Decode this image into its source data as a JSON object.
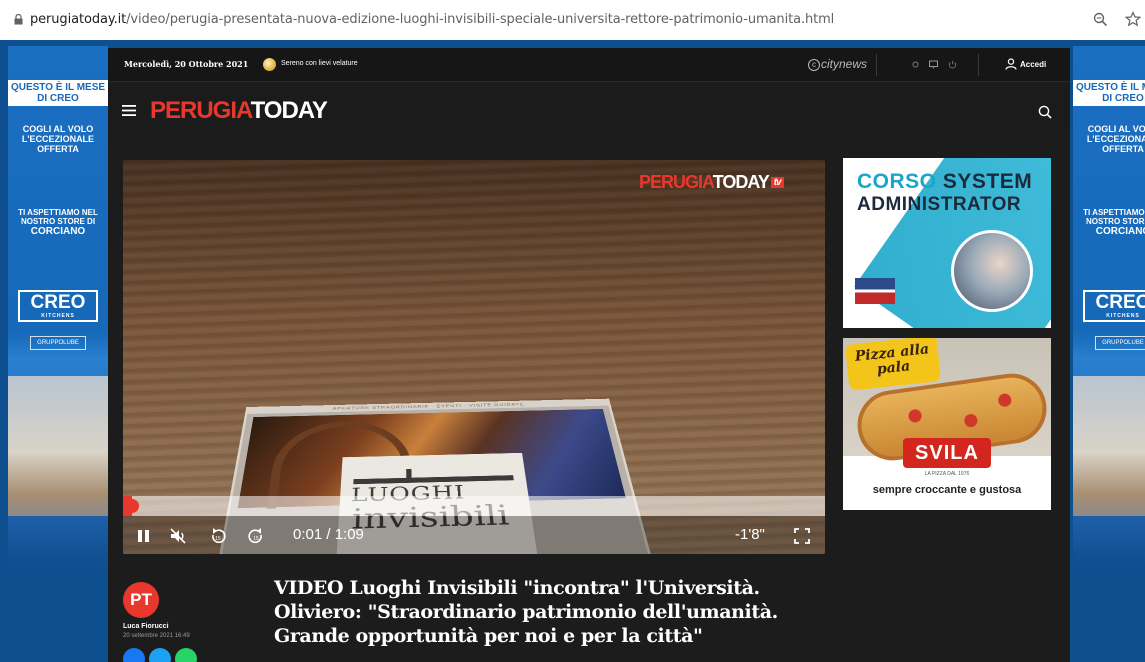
{
  "browser": {
    "url_host": "perugiatoday.it",
    "url_path": "/video/perugia-presentata-nuova-edizione-luoghi-invisibili-speciale-universita-rettore-patrimonio-umanita.html"
  },
  "side_ad": {
    "tag": "QUESTO È IL MESE DI CREO",
    "offer": "COGLI AL VOLO L'ECCEZIONALE OFFERTA",
    "store_intro": "TI ASPETTIAMO NEL NOSTRO STORE DI",
    "store_city": "CORCIANO",
    "brand": "CREO",
    "brand_sub": "KITCHENS",
    "group": "GRUPPOLUBE"
  },
  "topbar": {
    "date": "Mercoledì, 20 Ottobre 2021",
    "weather": "Sereno con lievi velature",
    "network": "citynews",
    "login": "Accedi"
  },
  "header": {
    "logo_part1": "PERUGIA",
    "logo_part2": "TODAY"
  },
  "video": {
    "watermark_part1": "PERUGIA",
    "watermark_part2": "TODAY",
    "watermark_tv": "tv",
    "book_band": "APERTURE STRAORDINARIE · EVENTI · VISITE GUIDATE",
    "book_title1": "LUOGHI",
    "book_title2": "invisibili",
    "progress": 0.013,
    "time": "0:01 / 1:09",
    "remaining": "-1'8\""
  },
  "ads": {
    "course_line1a": "CORSO",
    "course_line1b": "SYSTEM",
    "course_line2": "ADMINISTRATOR",
    "pizza_badge": "Pizza alla pala",
    "pizza_brand": "SVILA",
    "pizza_since": "LA PIZZA DAL 1976",
    "pizza_slogan": "sempre croccante e gustosa"
  },
  "article": {
    "avatar_initials": "PT",
    "author": "Luca Fiorucci",
    "date": "20 settembre 2021 16:49",
    "title": "VIDEO Luoghi Invisibili \"incontra\" l'Università. Oliviero: \"Straordinario patrimonio dell'umanità. Grande opportunità per noi e per la città\""
  },
  "colors": {
    "brand_red": "#e8372c",
    "page_blue": "#0e4f8f",
    "dark": "#1c1c1c"
  }
}
